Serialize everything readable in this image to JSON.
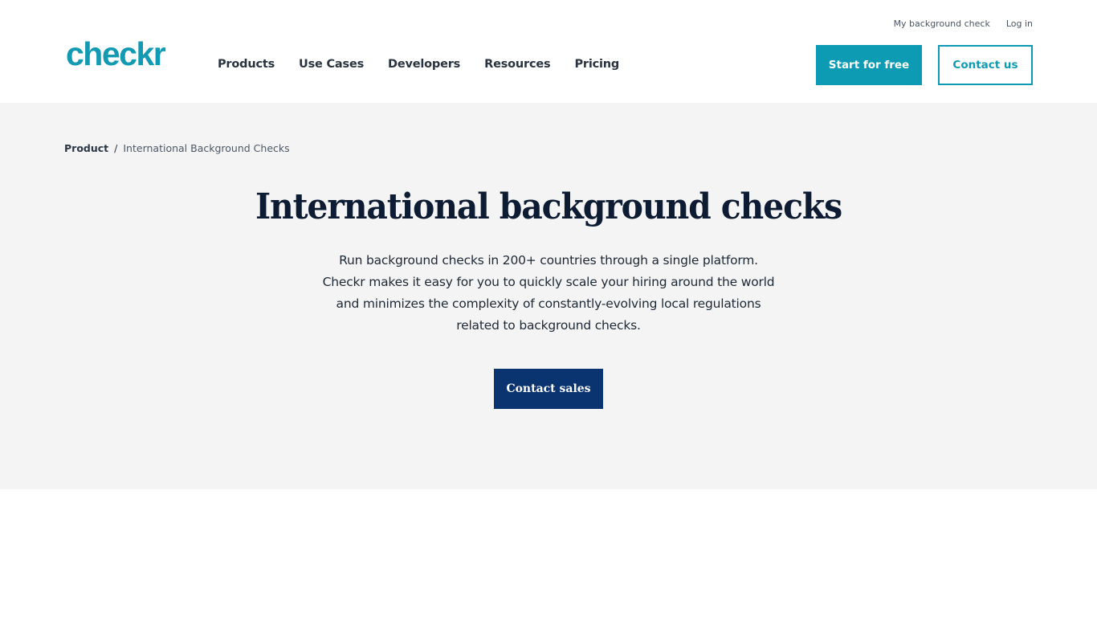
{
  "header": {
    "logo": "checkr",
    "nav": [
      "Products",
      "Use Cases",
      "Developers",
      "Resources",
      "Pricing"
    ],
    "utility_links": [
      "My background check",
      "Log in"
    ],
    "start_button": "Start for free",
    "contact_button": "Contact us"
  },
  "breadcrumb": {
    "root": "Product",
    "separator": "/",
    "current": "International Background Checks"
  },
  "hero": {
    "title": "International background checks",
    "description_lines": [
      "Run background checks in 200+ countries through a single platform.",
      "Checkr makes it easy for you to quickly scale your hiring around the world",
      "and minimizes the complexity of constantly-evolving local regulations",
      "related to background checks."
    ],
    "cta": "Contact sales"
  },
  "colors": {
    "brand_teal": "#0c9bb3",
    "navy": "#0a3470",
    "hero_bg": "#f4f4f4",
    "title": "#0d1b33"
  }
}
